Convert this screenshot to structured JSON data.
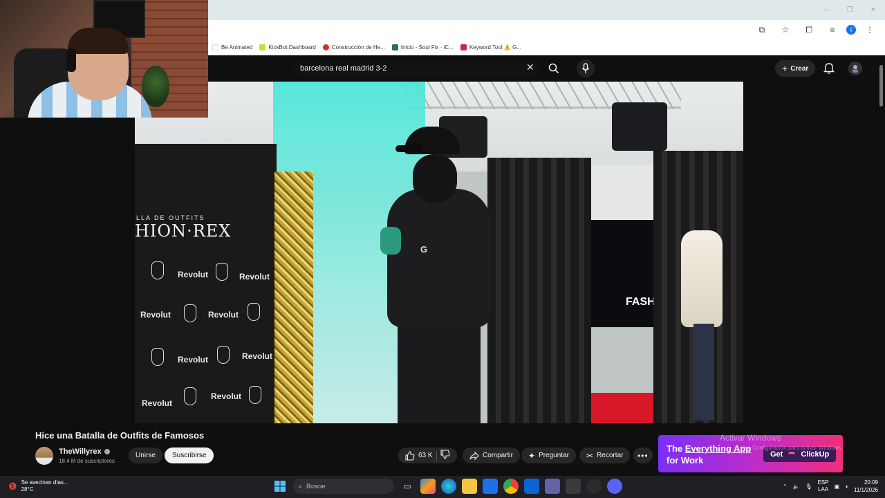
{
  "browser": {
    "bookmarks": [
      {
        "label": "Be Animated",
        "color": "#ffffff"
      },
      {
        "label": "KickBot Dashboard",
        "color": "#c6e03a"
      },
      {
        "label": "Construcción de He...",
        "color": "#d32f2f"
      },
      {
        "label": "Inicio - Soul Fix · iC...",
        "color": "#2f6f4a"
      },
      {
        "label": "Keyword Tool ⚠️ G...",
        "color": "#d81b60"
      }
    ],
    "profile_initial": "I"
  },
  "youtube": {
    "search_query": "barcelona real madrid 3-2",
    "create_label": "Crear"
  },
  "video_scene": {
    "banner_top": "LLA DE OUTFITS",
    "banner_main": "HION·REX",
    "sponsor": "Revolut",
    "screen_text": "FASHIO",
    "shirt_letter": "G"
  },
  "video": {
    "title": "Hice una Batalla de Outfits de Famosos",
    "channel_name": "TheWillyrex",
    "subscribers": "18.4 M de suscriptores",
    "join_label": "Unirse",
    "subscribe_label": "Suscribirse",
    "likes": "63 K",
    "share_label": "Compartir",
    "ask_label": "Preguntar",
    "clip_label": "Recortar"
  },
  "ad": {
    "line1_a": "The ",
    "line1_b": "Everything App",
    "line2": "for Work",
    "cta": "Get",
    "brand": "ClickUp"
  },
  "watermark": {
    "line1": "Activar Windows",
    "line2": "Ve a Configuración para activar Windows."
  },
  "taskbar": {
    "weather_line1": "Se avecinan días...",
    "weather_line2": "28°C",
    "search_placeholder": "Buscar",
    "lang1": "ESP",
    "lang2": "LAA",
    "time": "20:09",
    "date": "11/1/2026"
  }
}
